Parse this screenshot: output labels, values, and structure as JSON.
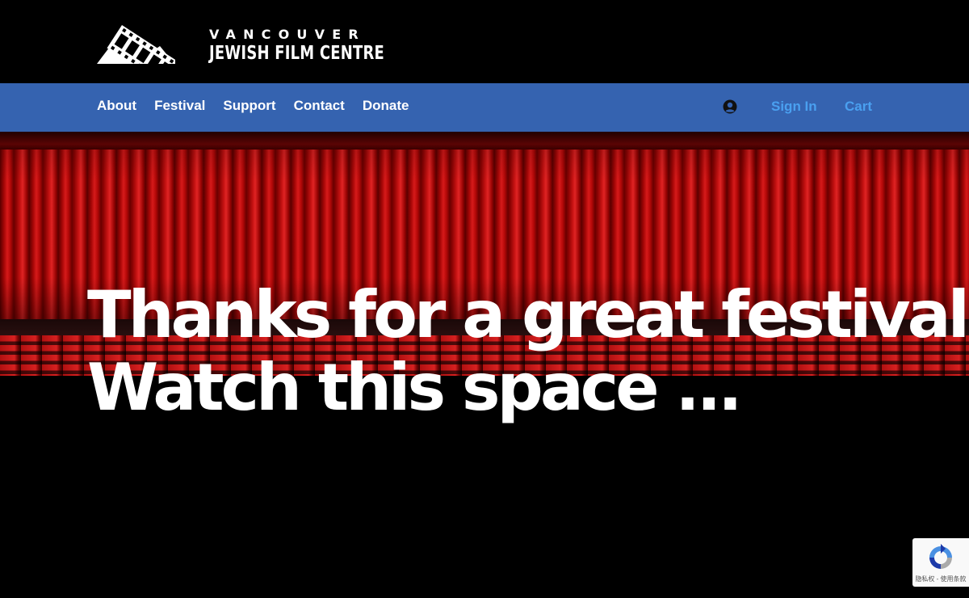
{
  "header": {
    "logo_line1": "VANCOUVER",
    "logo_line2": "JEWISH FILM CENTRE"
  },
  "nav": {
    "links": [
      {
        "label": "About"
      },
      {
        "label": "Festival"
      },
      {
        "label": "Support"
      },
      {
        "label": "Contact"
      },
      {
        "label": "Donate"
      }
    ],
    "account_icon": "user-circle-icon",
    "signin_label": "Sign In",
    "cart_label": "Cart"
  },
  "hero": {
    "image": "red-theatre-curtain",
    "headline_line1": "Thanks for a great festival!",
    "headline_line2": "Watch this space ..."
  },
  "recaptcha": {
    "text": "隐私权 - 使用条款"
  },
  "colors": {
    "header_bg": "#000000",
    "nav_bg": "#3563b0",
    "nav_text": "#ffffff",
    "account_link": "#4aa0f0",
    "page_bg": "#000000"
  }
}
